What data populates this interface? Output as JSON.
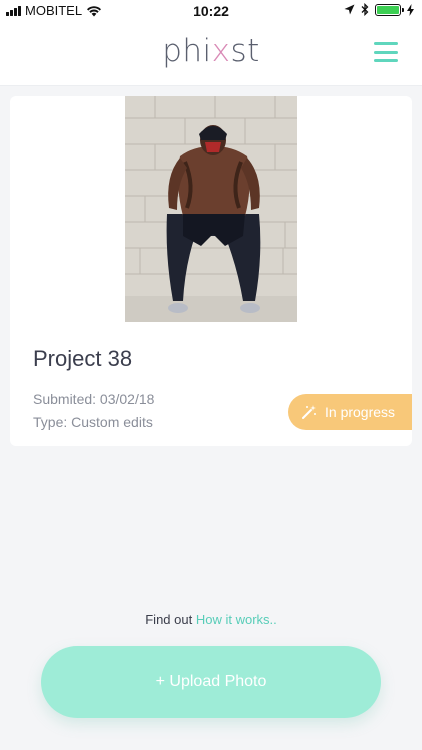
{
  "status_bar": {
    "carrier": "MOBITEL",
    "time": "10:22",
    "battery_level": 1.0,
    "icons": [
      "signal-icon",
      "wifi-icon",
      "location-icon",
      "bluetooth-icon",
      "battery-icon",
      "charging-icon"
    ]
  },
  "header": {
    "logo_text": "phixst",
    "menu_icon": "hamburger-menu-icon",
    "accent_color": "#5fd6bd"
  },
  "project": {
    "photo_icon": "project-photo",
    "title": "Project 38",
    "submitted": "Submited: 03/02/18",
    "type": "Type: Custom edits",
    "status": "In progress",
    "status_icon": "magic-wand-icon",
    "status_color": "#f8c879"
  },
  "footer": {
    "find_out_text": "Find out",
    "how_it_works_link": "How it works..",
    "upload_button": "+ Upload Photo",
    "upload_color": "#9eecd7"
  }
}
